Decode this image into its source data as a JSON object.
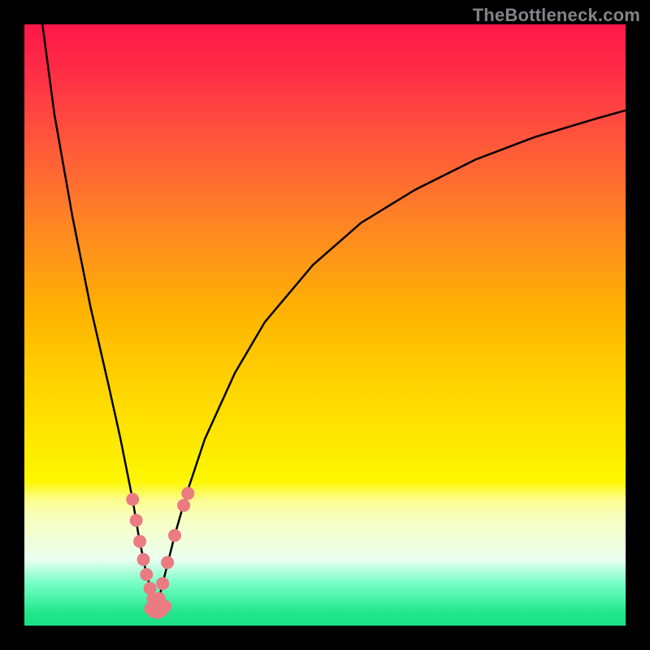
{
  "watermark": "TheBottleneck.com",
  "colors": {
    "background": "#000000",
    "curve_stroke": "#000000",
    "dot_fill": "#ea7c81",
    "gradient_top": "#ff1748",
    "gradient_bottom": "#1ae086"
  },
  "chart_data": {
    "type": "line",
    "title": "",
    "xlabel": "",
    "ylabel": "",
    "xlim": [
      0,
      100
    ],
    "ylim": [
      0,
      100
    ],
    "axes_visible": false,
    "grid": false,
    "legend": false,
    "series": [
      {
        "name": "left-curve",
        "x": [
          3.0,
          5.0,
          8.0,
          11.0,
          14.0,
          16.0,
          18.0,
          19.0,
          20.0,
          21.0,
          22.0
        ],
        "y": [
          100.0,
          85.0,
          68.0,
          53.0,
          40.0,
          31.0,
          21.0,
          15.0,
          10.0,
          6.0,
          3.0
        ]
      },
      {
        "name": "right-curve",
        "x": [
          22.0,
          23.0,
          25.0,
          27.0,
          30.0,
          35.0,
          40.0,
          48.0,
          56.0,
          65.0,
          75.0,
          85.0,
          95.0,
          100.0
        ],
        "y": [
          3.0,
          7.0,
          15.0,
          22.0,
          31.0,
          42.0,
          50.5,
          60.0,
          67.0,
          72.5,
          77.5,
          81.3,
          84.3,
          85.7
        ]
      },
      {
        "name": "data-points-left",
        "type": "scatter",
        "x": [
          18.0,
          18.6,
          19.2,
          19.8,
          20.3,
          20.9,
          21.4,
          21.9
        ],
        "y": [
          21.0,
          17.5,
          14.0,
          11.0,
          8.5,
          6.2,
          4.5,
          3.3
        ]
      },
      {
        "name": "data-points-right",
        "type": "scatter",
        "x": [
          22.4,
          23.0,
          23.8,
          25.0,
          26.5,
          27.2
        ],
        "y": [
          4.5,
          7.0,
          10.5,
          15.0,
          20.0,
          22.0
        ]
      },
      {
        "name": "data-points-bottom",
        "type": "scatter",
        "x": [
          21.0,
          21.6,
          22.2,
          22.8,
          23.4
        ],
        "y": [
          2.8,
          2.3,
          2.2,
          2.5,
          3.2
        ]
      }
    ]
  }
}
